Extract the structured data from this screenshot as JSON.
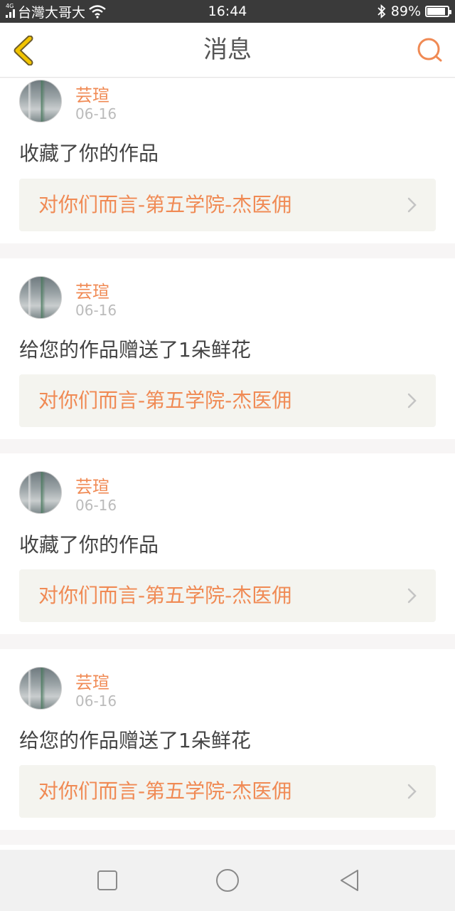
{
  "status_bar": {
    "network_tag": "4G",
    "carrier": "台灣大哥大",
    "time": "16:44",
    "battery_percent": "89%",
    "battery_level": 0.89,
    "icons": [
      "signal-icon",
      "wifi-icon",
      "bluetooth-icon",
      "battery-icon"
    ]
  },
  "header": {
    "title": "消息",
    "back_icon": "chevron-left-icon",
    "search_icon": "search-icon",
    "accent_color": "#f08a54",
    "back_color": "#f2c400"
  },
  "messages": [
    {
      "user": "芸瑄",
      "date": "06-16",
      "action": "收藏了你的作品",
      "work": "对你们而言-第五学院-杰医佣"
    },
    {
      "user": "芸瑄",
      "date": "06-16",
      "action": "给您的作品赠送了1朵鲜花",
      "work": "对你们而言-第五学院-杰医佣"
    },
    {
      "user": "芸瑄",
      "date": "06-16",
      "action": "收藏了你的作品",
      "work": "对你们而言-第五学院-杰医佣"
    },
    {
      "user": "芸瑄",
      "date": "06-16",
      "action": "给您的作品赠送了1朵鲜花",
      "work": "对你们而言-第五学院-杰医佣"
    }
  ],
  "nav_bar": {
    "icons": [
      "recent-apps-icon",
      "home-icon",
      "back-icon"
    ]
  }
}
